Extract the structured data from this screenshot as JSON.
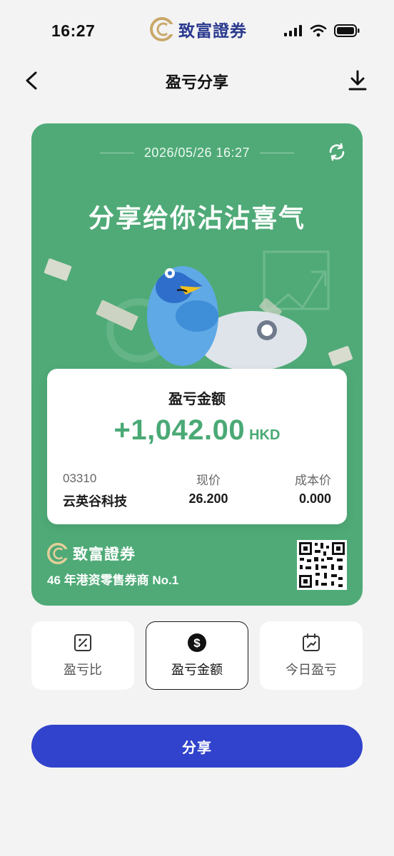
{
  "status_bar": {
    "time": "16:27",
    "brand": "致富證券",
    "icons": [
      "signal-icon",
      "wifi-icon",
      "battery-icon"
    ]
  },
  "nav": {
    "title": "盈亏分享",
    "back_icon": "back-arrow-icon",
    "download_icon": "download-icon"
  },
  "card": {
    "background": "#4faa77",
    "datetime": "2026/05/26 16:27",
    "headline": "分享给你沾沾喜气",
    "refresh_icon": "refresh-icon",
    "amount_label": "盈亏金额",
    "amount_value": "+1,042.00",
    "amount_currency": "HKD",
    "amount_color": "#4aa975",
    "stock_code": "03310",
    "stock_name": "云英谷科技",
    "price_label": "现价",
    "price_value": "26.200",
    "cost_label": "成本价",
    "cost_value": "0.000",
    "brand": "致富證券",
    "slogan": "46 年港资零售券商 No.1",
    "qr_icon": "qr-code-icon"
  },
  "modes": [
    {
      "label": "盈亏比",
      "icon": "percent-icon",
      "selected": false
    },
    {
      "label": "盈亏金额",
      "icon": "dollar-icon",
      "selected": true
    },
    {
      "label": "今日盈亏",
      "icon": "calendar-trend-icon",
      "selected": false
    }
  ],
  "share_button": {
    "label": "分享",
    "color": "#3143cc"
  }
}
